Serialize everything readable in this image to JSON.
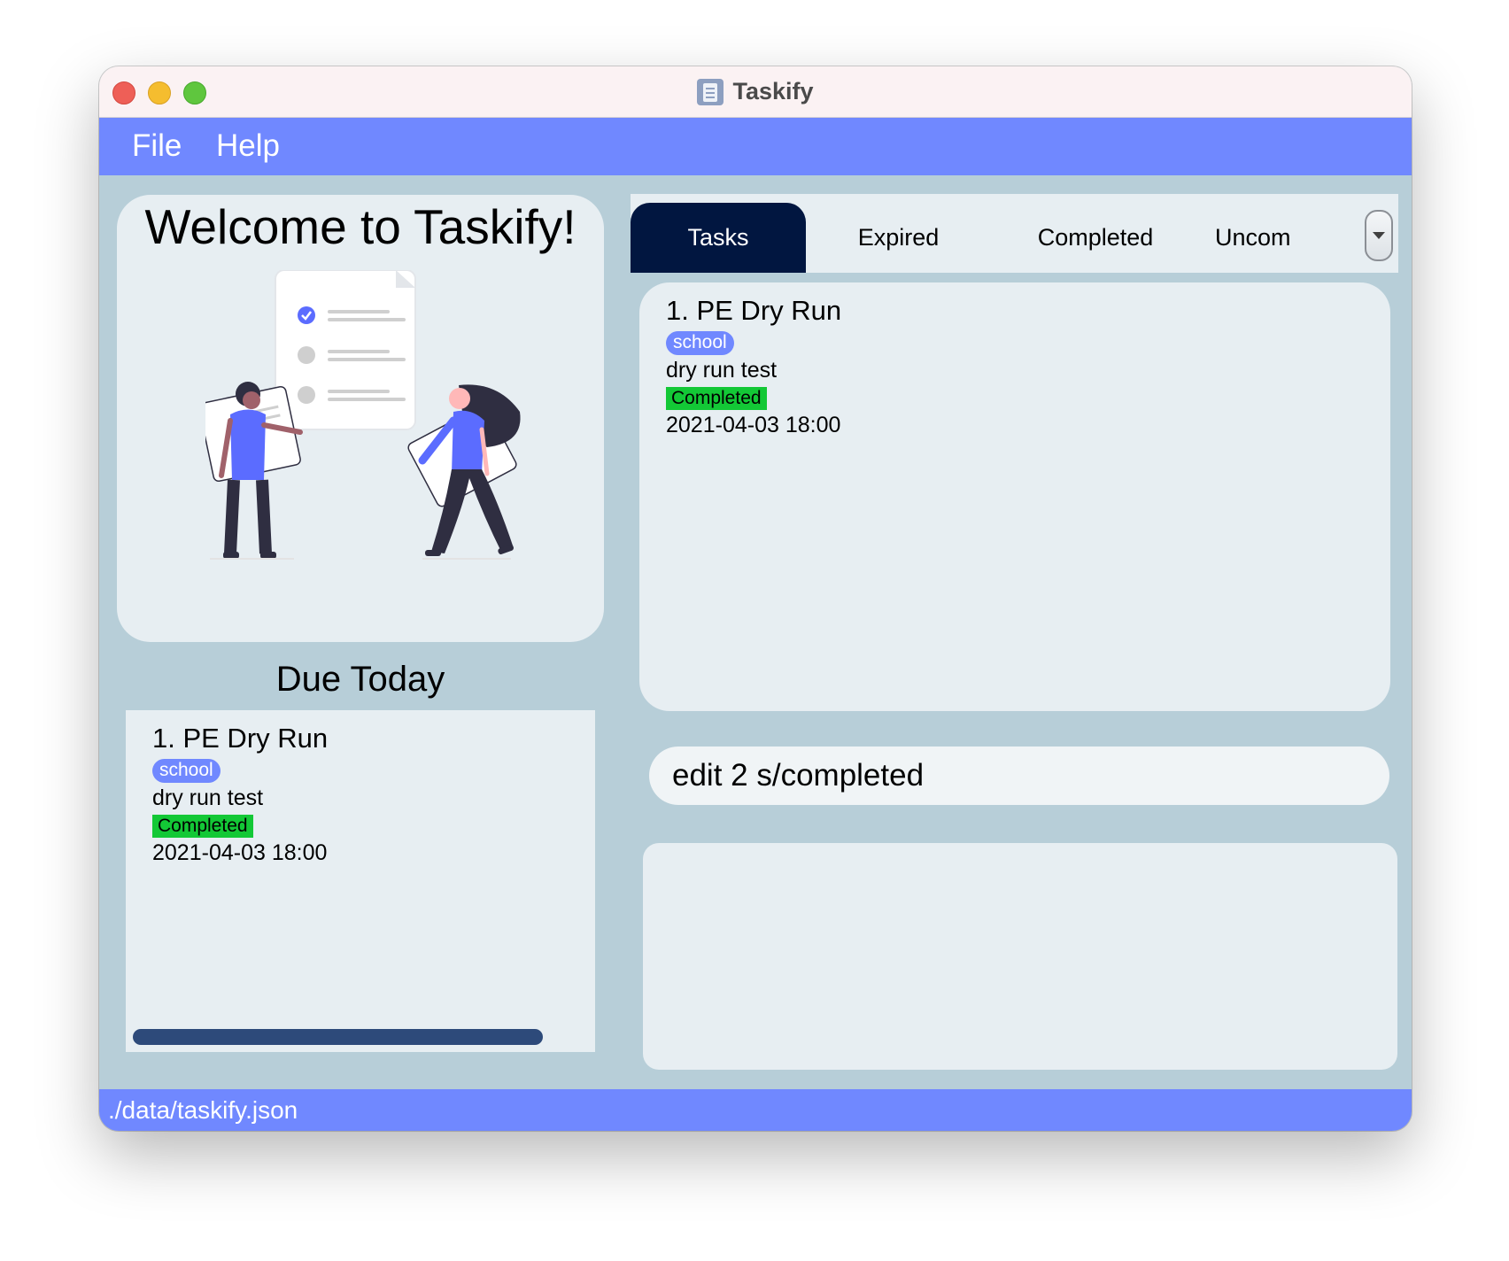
{
  "window": {
    "title": "Taskify"
  },
  "menu": {
    "file_label": "File",
    "help_label": "Help"
  },
  "welcome": {
    "title": "Welcome to Taskify!"
  },
  "due_today": {
    "title": "Due Today",
    "tasks": [
      {
        "index_name": "1.  PE Dry Run",
        "tag": "school",
        "description": "dry run test",
        "status": "Completed",
        "date": "2021-04-03 18:00"
      }
    ]
  },
  "tabs": [
    {
      "label": "Tasks",
      "active": true
    },
    {
      "label": "Expired",
      "active": false
    },
    {
      "label": "Completed",
      "active": false
    },
    {
      "label": "Uncom",
      "active": false
    }
  ],
  "task_list": [
    {
      "index_name": "1.  PE Dry Run",
      "tag": "school",
      "description": "dry run test",
      "status": "Completed",
      "date": "2021-04-03 18:00"
    }
  ],
  "command": {
    "value": "edit 2 s/completed"
  },
  "result": {
    "text": ""
  },
  "status_bar": {
    "file_path": "./data/taskify.json"
  },
  "colors": {
    "accent": "#7088ff",
    "active_tab": "#011640",
    "completed_status": "#13c836",
    "background": "#b7ced8",
    "panel": "#e7eef2"
  },
  "icons": {
    "app": "clipboard-icon",
    "dropdown": "chevron-down-icon"
  }
}
